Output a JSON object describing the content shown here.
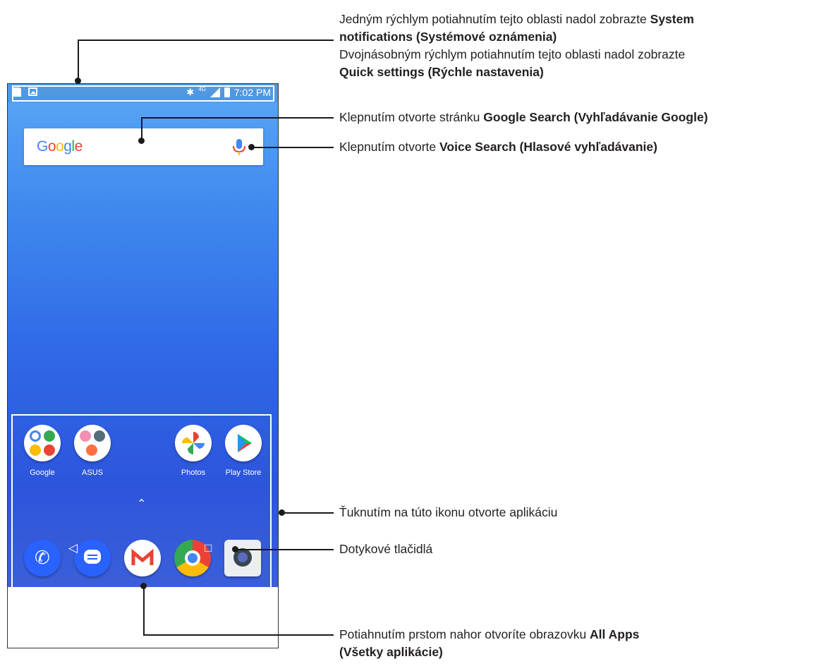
{
  "phone": {
    "status_time": "7:02 PM",
    "status_network": "4G",
    "search_logo": "Google",
    "apps_row1": [
      {
        "label": "Google",
        "icon": "google-folder-icon"
      },
      {
        "label": "ASUS",
        "icon": "asus-folder-icon"
      },
      {
        "label": "Photos",
        "icon": "photos-icon"
      },
      {
        "label": "Play Store",
        "icon": "play-store-icon"
      }
    ],
    "dock": [
      {
        "icon": "phone-icon"
      },
      {
        "icon": "messages-icon"
      },
      {
        "icon": "gmail-icon"
      },
      {
        "icon": "chrome-icon"
      },
      {
        "icon": "camera-icon"
      }
    ],
    "nav_back": "◁",
    "nav_home": "○",
    "nav_recents": "□",
    "chevron": "⌃"
  },
  "callouts": {
    "status_line1_pre": "Jedným rýchlym potiahnutím tejto oblasti nadol zobrazte ",
    "status_line1_bold": "System",
    "status_line2_bold": "notifications (Systémové oznámenia)",
    "status_line3": "Dvojnásobným rýchlym potiahnutím tejto oblasti nadol zobrazte",
    "status_line4_bold": "Quick settings (Rýchle nastavenia)",
    "search_pre": "Klepnutím otvorte stránku ",
    "search_bold": "Google Search (Vyhľadávanie Google)",
    "voice_pre": "Klepnutím otvorte ",
    "voice_bold": "Voice Search (Hlasové vyhľadávanie)",
    "apps_text": "Ťuknutím na túto ikonu otvorte aplikáciu",
    "keys_text": "Dotykové tlačidlá",
    "allapps_pre": "Potiahnutím prstom nahor otvoríte obrazovku ",
    "allapps_bold1": "All Apps",
    "allapps_bold2": "(Všetky aplikácie)"
  },
  "colors": {
    "screen_top": "#5aa7f6",
    "screen_bottom": "#3b5fd9",
    "text": "#231f20"
  }
}
